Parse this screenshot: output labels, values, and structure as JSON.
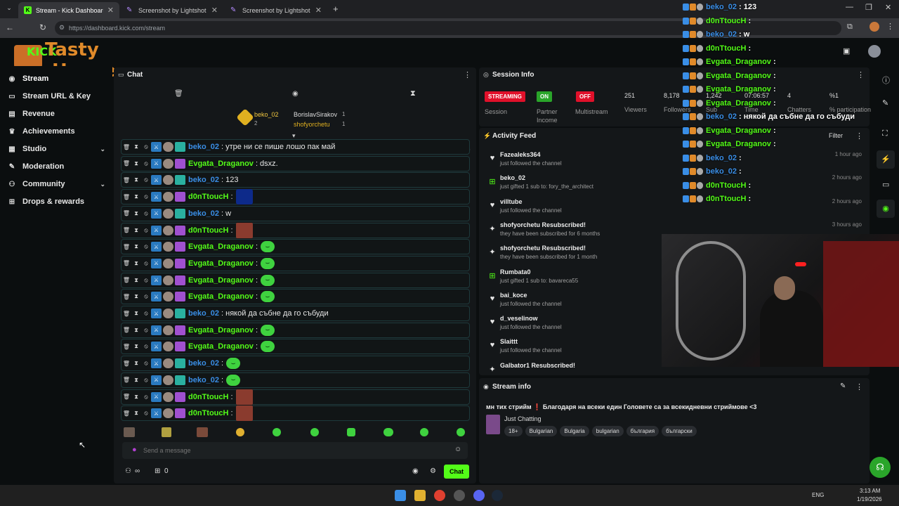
{
  "browser": {
    "tabs": [
      {
        "title": "Stream - Kick Dashboard",
        "active": true
      },
      {
        "title": "Screenshot by Lightshot",
        "active": false
      },
      {
        "title": "Screenshot by Lightshot",
        "active": false
      }
    ],
    "url": "https://dashboard.kick.com/stream"
  },
  "logo": {
    "text_top": "Tasty",
    "text_bottom": "House",
    "kick": "KICK"
  },
  "sidebar": {
    "items": [
      {
        "label": "Stream",
        "icon": "broadcast-icon"
      },
      {
        "label": "Stream URL & Key",
        "icon": "key-icon"
      },
      {
        "label": "Revenue",
        "icon": "chart-icon"
      },
      {
        "label": "Achievements",
        "icon": "trophy-icon"
      },
      {
        "label": "Studio",
        "icon": "studio-icon",
        "chevron": true
      },
      {
        "label": "Moderation",
        "icon": "wrench-icon"
      },
      {
        "label": "Community",
        "icon": "people-icon",
        "chevron": true
      },
      {
        "label": "Drops & rewards",
        "icon": "gift-icon"
      }
    ]
  },
  "chat": {
    "title": "Chat",
    "top_gifters": [
      {
        "name": "beko_02",
        "count": "1",
        "rank": "2"
      },
      {
        "name": "BorislavSirakov",
        "count": "1"
      },
      {
        "name": "shofyorchetu",
        "count": "1"
      }
    ],
    "messages": [
      {
        "user": "beko_02",
        "color": "#3a8ee6",
        "text": ": утре ни се пише лошо пак май",
        "emote": ""
      },
      {
        "user": "Evgata_Draganov",
        "color": "#53fc18",
        "text": ": dsxz.",
        "emote": ""
      },
      {
        "user": "beko_02",
        "color": "#3a8ee6",
        "text": ": 123",
        "emote": ""
      },
      {
        "user": "d0nTtoucH",
        "color": "#53fc18",
        "text": ":",
        "emote": "blue"
      },
      {
        "user": "beko_02",
        "color": "#3a8ee6",
        "text": ": w",
        "emote": ""
      },
      {
        "user": "d0nTtoucH",
        "color": "#53fc18",
        "text": ":",
        "emote": "face"
      },
      {
        "user": "Evgata_Draganov",
        "color": "#53fc18",
        "text": ":",
        "emote": "green"
      },
      {
        "user": "Evgata_Draganov",
        "color": "#53fc18",
        "text": ":",
        "emote": "green"
      },
      {
        "user": "Evgata_Draganov",
        "color": "#53fc18",
        "text": ":",
        "emote": "green"
      },
      {
        "user": "Evgata_Draganov",
        "color": "#53fc18",
        "text": ":",
        "emote": "green"
      },
      {
        "user": "beko_02",
        "color": "#3a8ee6",
        "text": ": някой да събне да го събуди",
        "emote": ""
      },
      {
        "user": "Evgata_Draganov",
        "color": "#53fc18",
        "text": ":",
        "emote": "green"
      },
      {
        "user": "Evgata_Draganov",
        "color": "#53fc18",
        "text": ":",
        "emote": "green"
      },
      {
        "user": "beko_02",
        "color": "#3a8ee6",
        "text": ":",
        "emote": "green"
      },
      {
        "user": "beko_02",
        "color": "#3a8ee6",
        "text": ":",
        "emote": "green"
      },
      {
        "user": "d0nTtoucH",
        "color": "#53fc18",
        "text": ":",
        "emote": "face"
      },
      {
        "user": "d0nTtoucH",
        "color": "#53fc18",
        "text": ":",
        "emote": "face"
      }
    ],
    "input_placeholder": "Send a message",
    "send_label": "Chat",
    "viewer_count": "0",
    "infinity": "∞"
  },
  "session": {
    "title": "Session Info",
    "pills": [
      {
        "label": "STREAMING",
        "color": "#e0102a"
      },
      {
        "label": "ON",
        "color": "#2aa52a"
      },
      {
        "label": "OFF",
        "color": "#e0102a"
      }
    ],
    "pill_labels": [
      "Session",
      "Partner Income",
      "Multistream"
    ],
    "stats": [
      {
        "value": "251",
        "label": "Viewers"
      },
      {
        "value": "8,178",
        "label": "Followers"
      },
      {
        "value": "1,242",
        "label": "Sub"
      },
      {
        "value": "07:06:57",
        "label": "Time"
      },
      {
        "value": "4",
        "label": "Chatters"
      },
      {
        "value": "%1",
        "label": "% participation"
      }
    ]
  },
  "activity": {
    "title": "Activity Feed",
    "filter_label": "Filter",
    "items": [
      {
        "icon": "heart-icon",
        "name": "Fazealeks364",
        "sub": "just followed the channel",
        "time": "1 hour ago"
      },
      {
        "icon": "gift-icon",
        "name": "beko_02",
        "sub": "just gifted 1 sub to: fory_the_architect",
        "time": "2 hours ago"
      },
      {
        "icon": "heart-icon",
        "name": "villtube",
        "sub": "just followed the channel",
        "time": "2 hours ago"
      },
      {
        "icon": "star-icon",
        "name": "shofyorchetu Resubscribed!",
        "sub": "they have been subscribed for 6 months",
        "time": "3 hours ago"
      },
      {
        "icon": "star-icon",
        "name": "shofyorchetu Resubscribed!",
        "sub": "they have been subscribed for 1 month",
        "time": ""
      },
      {
        "icon": "gift-icon",
        "name": "Rumbata0",
        "sub": "just gifted 1 sub to: bavareca55",
        "time": ""
      },
      {
        "icon": "heart-icon",
        "name": "bai_koce",
        "sub": "just followed the channel",
        "time": ""
      },
      {
        "icon": "heart-icon",
        "name": "d_veselinow",
        "sub": "just followed the channel",
        "time": ""
      },
      {
        "icon": "heart-icon",
        "name": "Slaittt",
        "sub": "just followed the channel",
        "time": ""
      },
      {
        "icon": "star-icon",
        "name": "Galbator1 Resubscribed!",
        "sub": "",
        "time": ""
      }
    ]
  },
  "stream_info": {
    "title": "Stream info",
    "stream_title": "мн тих стрийм  ❗ Благодаря на всеки един Головете са за всекидневни стриймове <3",
    "category": "Just Chatting",
    "tags": [
      "18+",
      "Bulgarian",
      "Bulgaria",
      "bulgarian",
      "българия",
      "български"
    ]
  },
  "overlay": {
    "rows": [
      {
        "user": "beko_02",
        "color": "#3a8ee6",
        "text": ": 123"
      },
      {
        "user": "d0nTtoucH",
        "color": "#53fc18",
        "text": ":"
      },
      {
        "user": "beko_02",
        "color": "#3a8ee6",
        "text": ": w"
      },
      {
        "user": "d0nTtoucH",
        "color": "#53fc18",
        "text": ":"
      },
      {
        "user": "Evgata_Draganov",
        "color": "#53fc18",
        "text": ":"
      },
      {
        "user": "Evgata_Draganov",
        "color": "#53fc18",
        "text": ":"
      },
      {
        "user": "Evgata_Draganov",
        "color": "#53fc18",
        "text": ":"
      },
      {
        "user": "Evgata_Draganov",
        "color": "#53fc18",
        "text": ":"
      },
      {
        "user": "beko_02",
        "color": "#3a8ee6",
        "text": ": някой да събне да го събуди"
      },
      {
        "user": "Evgata_Draganov",
        "color": "#53fc18",
        "text": ":"
      },
      {
        "user": "Evgata_Draganov",
        "color": "#53fc18",
        "text": ":"
      },
      {
        "user": "beko_02",
        "color": "#3a8ee6",
        "text": ":"
      },
      {
        "user": "beko_02",
        "color": "#3a8ee6",
        "text": ":"
      },
      {
        "user": "d0nTtoucH",
        "color": "#53fc18",
        "text": ":"
      },
      {
        "user": "d0nTtoucH",
        "color": "#53fc18",
        "text": ":"
      }
    ]
  },
  "taskbar": {
    "lang": "ENG",
    "time": "3:13 AM",
    "date": "1/19/2026"
  }
}
